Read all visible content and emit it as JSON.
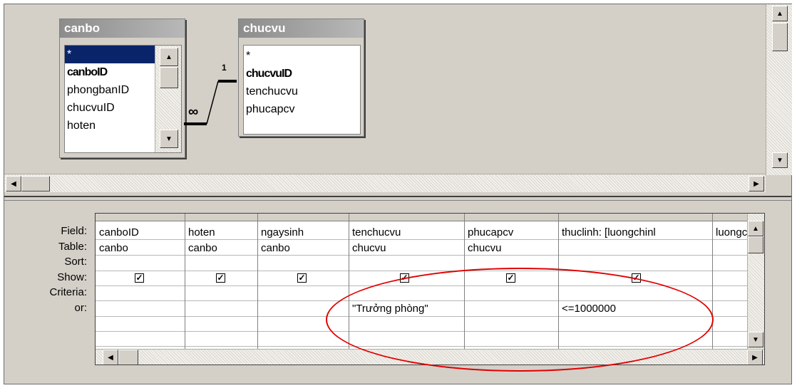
{
  "tables": {
    "canbo": {
      "title": "canbo",
      "fields": [
        "*",
        "canboID",
        "phongbanID",
        "chucvuID",
        "hoten"
      ]
    },
    "chucvu": {
      "title": "chucvu",
      "fields": [
        "*",
        "chucvuID",
        "tenchucvu",
        "phucapcv"
      ]
    }
  },
  "relationship": {
    "one_label": "1",
    "many_label": "∞"
  },
  "grid": {
    "row_labels": [
      "Field:",
      "Table:",
      "Sort:",
      "Show:",
      "Criteria:",
      "or:"
    ],
    "columns": [
      {
        "field": "canboID",
        "table": "canbo",
        "show": true,
        "criteria": ""
      },
      {
        "field": "hoten",
        "table": "canbo",
        "show": true,
        "criteria": ""
      },
      {
        "field": "ngaysinh",
        "table": "canbo",
        "show": true,
        "criteria": ""
      },
      {
        "field": "tenchucvu",
        "table": "chucvu",
        "show": true,
        "criteria": "\"Trưởng phòng\""
      },
      {
        "field": "phucapcv",
        "table": "chucvu",
        "show": true,
        "criteria": ""
      },
      {
        "field": "thuclinh: [luongchinl",
        "table": "",
        "show": true,
        "criteria": "<=1000000"
      },
      {
        "field": "luongch",
        "table": "",
        "show": null,
        "criteria": ""
      }
    ]
  },
  "colors": {
    "highlight_ellipse": "#e00000",
    "selection": "#0a246a"
  }
}
